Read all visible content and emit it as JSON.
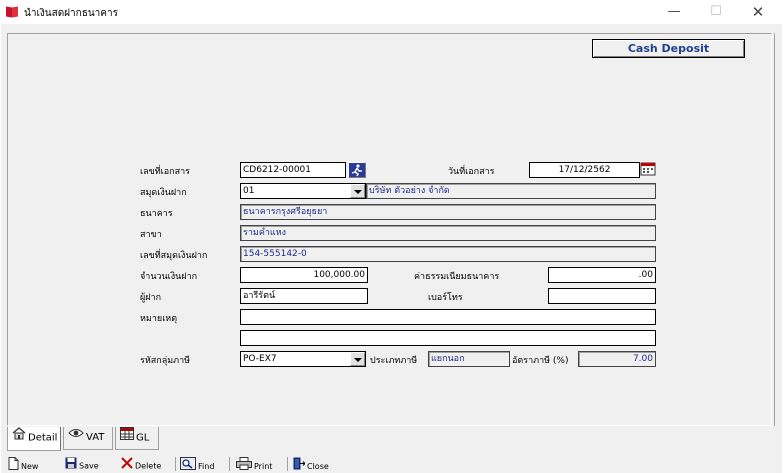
{
  "window": {
    "title": "นำเงินสดฝากธนาคาร",
    "minimize": "—",
    "maximize": "☐",
    "close": "✕"
  },
  "banner": "Cash Deposit",
  "form": {
    "doc_no": {
      "label": "เลขที่เอกสาร",
      "value": "CD6212-00001"
    },
    "doc_date": {
      "label": "วันที่เอกสาร",
      "value": "17/12/2562"
    },
    "bank_book": {
      "label": "สมุดเงินฝาก",
      "code": "01",
      "name": "บริษัท ตัวอย่าง จำกัด"
    },
    "bank": {
      "label": "ธนาคาร",
      "value": "ธนาคารกรุงศรีอยุธยา"
    },
    "branch": {
      "label": "สาขา",
      "value": "รามคำแหง"
    },
    "account_no": {
      "label": "เลขที่สมุดเงินฝาก",
      "value": "154-555142-0"
    },
    "amount": {
      "label": "จำนวนเงินฝาก",
      "value": "100,000.00"
    },
    "bank_fee": {
      "label": "ค่าธรรมเนียมธนาคาร",
      "value": ".00"
    },
    "depositor": {
      "label": "ผู้ฝาก",
      "value": "อารีรัตน์"
    },
    "phone": {
      "label": "เบอร์โทร",
      "value": ""
    },
    "remark": {
      "label": "หมายเหตุ",
      "line1": "",
      "line2": ""
    },
    "tax_group": {
      "label": "รหัสกลุ่มภาษี",
      "value": "PO-EX7"
    },
    "tax_type": {
      "label": "ประเภทภาษี",
      "value": "แยกนอก"
    },
    "tax_rate": {
      "label": "อัตราภาษี (%)",
      "value": "7.00"
    }
  },
  "tabs": [
    {
      "label": "Detail",
      "icon": "house-icon",
      "active": true
    },
    {
      "label": "VAT",
      "icon": "eye-icon",
      "active": false
    },
    {
      "label": "GL",
      "icon": "grid-icon",
      "active": false
    }
  ],
  "toolbar": {
    "new": "New",
    "save": "Save",
    "delete": "Delete",
    "find": "Find",
    "print": "Print",
    "close": "Close"
  },
  "colors": {
    "value_blue": "#1a2a8a",
    "banner_text": "#1f3f8f",
    "panel_bg": "#f0f0f0",
    "delete_red": "#c00000"
  }
}
